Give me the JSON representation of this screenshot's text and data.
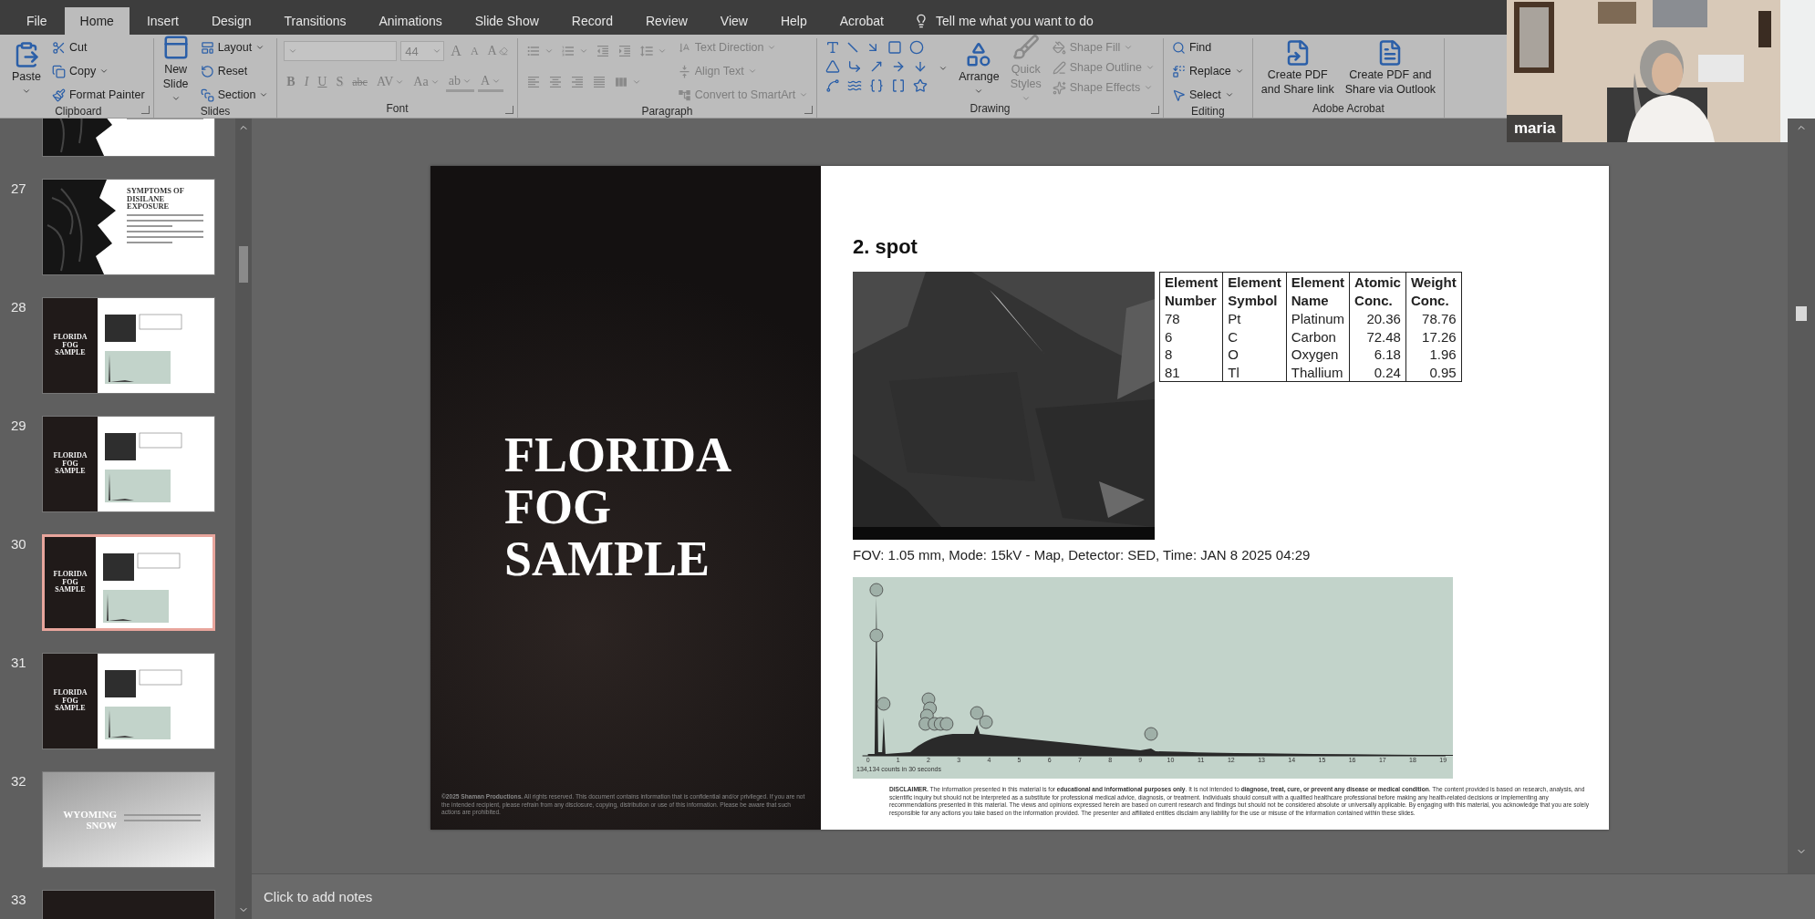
{
  "tabs": [
    {
      "label": "File",
      "selected": false
    },
    {
      "label": "Home",
      "selected": true
    },
    {
      "label": "Insert",
      "selected": false
    },
    {
      "label": "Design",
      "selected": false
    },
    {
      "label": "Transitions",
      "selected": false
    },
    {
      "label": "Animations",
      "selected": false
    },
    {
      "label": "Slide Show",
      "selected": false
    },
    {
      "label": "Record",
      "selected": false
    },
    {
      "label": "Review",
      "selected": false
    },
    {
      "label": "View",
      "selected": false
    },
    {
      "label": "Help",
      "selected": false
    },
    {
      "label": "Acrobat",
      "selected": false
    }
  ],
  "tell_me": "Tell me what you want to do",
  "ribbon": [
    {
      "label": "Clipboard",
      "kind": "clipboard",
      "launcher": true,
      "columns": [
        [
          [
            {
              "kind": "large",
              "label": "Paste",
              "dropdown": true,
              "disabled": false
            }
          ]
        ],
        [
          [
            {
              "kind": "small",
              "label": "Cut",
              "dropdown": false,
              "disabled": false
            }
          ],
          [
            {
              "kind": "small",
              "label": "Copy",
              "dropdown": true,
              "disabled": false
            }
          ],
          [
            {
              "kind": "small",
              "label": "Format Painter",
              "dropdown": false,
              "disabled": false
            }
          ]
        ]
      ]
    },
    {
      "label": "Slides",
      "kind": "slides",
      "launcher": false,
      "columns": [
        [
          [
            {
              "kind": "large",
              "label": "New\nSlide",
              "dropdown": true,
              "disabled": false
            }
          ]
        ],
        [
          [
            {
              "kind": "small",
              "label": "Layout",
              "dropdown": true,
              "disabled": false
            }
          ],
          [
            {
              "kind": "small",
              "label": "Reset",
              "dropdown": false,
              "disabled": false
            }
          ],
          [
            {
              "kind": "small",
              "label": "Section",
              "dropdown": true,
              "disabled": false
            }
          ]
        ]
      ]
    },
    {
      "label": "Font",
      "kind": "font",
      "launcher": true,
      "columns": [
        [
          [
            {
              "kind": "font-field",
              "dropdown": true,
              "disabled": true
            },
            {
              "kind": "size-field",
              "value": "44",
              "dropdown": true,
              "disabled": true
            },
            {
              "kind": "grow",
              "label": "A",
              "dropdown": false,
              "disabled": true
            },
            {
              "kind": "shrink",
              "label": "A",
              "dropdown": false,
              "disabled": true
            },
            {
              "kind": "clear",
              "label": "A",
              "dropdown": false,
              "disabled": true
            }
          ],
          [
            {
              "kind": "bold",
              "label": "B",
              "dropdown": false,
              "disabled": true
            },
            {
              "kind": "italic",
              "label": "I",
              "dropdown": false,
              "disabled": true
            },
            {
              "kind": "underline",
              "label": "U",
              "dropdown": false,
              "disabled": true
            },
            {
              "kind": "shadow",
              "label": "S",
              "dropdown": false,
              "disabled": true
            },
            {
              "kind": "strike",
              "label": "abc",
              "dropdown": false,
              "disabled": true
            },
            {
              "kind": "spacing",
              "label": "AV",
              "dropdown": true,
              "disabled": true
            },
            {
              "kind": "case",
              "label": "Aa",
              "dropdown": true,
              "disabled": true
            },
            {
              "kind": "highlight",
              "label": "ab",
              "dropdown": true,
              "disabled": true
            },
            {
              "kind": "color",
              "label": "A",
              "dropdown": true,
              "disabled": true
            }
          ]
        ]
      ]
    },
    {
      "label": "Paragraph",
      "kind": "paragraph",
      "launcher": true,
      "columns": [
        [
          [
            {
              "kind": "icon",
              "dropdown": true,
              "disabled": true
            },
            {
              "kind": "icon",
              "dropdown": true,
              "disabled": true
            },
            {
              "kind": "icon",
              "dropdown": false,
              "disabled": true
            },
            {
              "kind": "icon",
              "dropdown": false,
              "disabled": true
            },
            {
              "kind": "icon",
              "dropdown": true,
              "disabled": true
            }
          ],
          [
            {
              "kind": "icon",
              "dropdown": false,
              "disabled": true
            },
            {
              "kind": "icon",
              "dropdown": false,
              "disabled": true
            },
            {
              "kind": "icon",
              "dropdown": false,
              "disabled": true
            },
            {
              "kind": "icon",
              "dropdown": false,
              "disabled": true
            },
            {
              "kind": "icon",
              "dropdown": true,
              "disabled": true
            }
          ]
        ],
        [
          [
            {
              "kind": "small",
              "label": "Text Direction",
              "dropdown": true,
              "disabled": true
            }
          ],
          [
            {
              "kind": "small",
              "label": "Align Text",
              "dropdown": true,
              "disabled": true
            }
          ],
          [
            {
              "kind": "small",
              "label": "Convert to SmartArt",
              "dropdown": true,
              "disabled": true
            }
          ]
        ]
      ]
    },
    {
      "label": "Drawing",
      "kind": "drawing",
      "launcher": true,
      "columns": [
        [
          [
            {
              "kind": "icon",
              "dropdown": false,
              "disabled": false
            },
            {
              "kind": "icon",
              "dropdown": false,
              "disabled": false
            },
            {
              "kind": "icon",
              "dropdown": false,
              "disabled": false
            },
            {
              "kind": "icon",
              "dropdown": false,
              "disabled": false
            },
            {
              "kind": "icon",
              "dropdown": false,
              "disabled": false
            }
          ],
          [
            {
              "kind": "icon",
              "dropdown": false,
              "disabled": false
            },
            {
              "kind": "icon",
              "dropdown": false,
              "disabled": false
            },
            {
              "kind": "icon",
              "dropdown": false,
              "disabled": false
            },
            {
              "kind": "icon",
              "dropdown": false,
              "disabled": false
            },
            {
              "kind": "icon",
              "dropdown": false,
              "disabled": false
            }
          ],
          [
            {
              "kind": "icon",
              "dropdown": false,
              "disabled": false
            },
            {
              "kind": "icon",
              "dropdown": false,
              "disabled": false
            },
            {
              "kind": "icon",
              "dropdown": false,
              "disabled": false
            },
            {
              "kind": "icon",
              "dropdown": false,
              "disabled": false
            },
            {
              "kind": "icon",
              "dropdown": false,
              "disabled": false
            }
          ]
        ],
        [
          [
            {
              "kind": "more",
              "dropdown": true,
              "disabled": false
            }
          ]
        ],
        [
          [
            {
              "kind": "large",
              "label": "Arrange",
              "dropdown": true,
              "disabled": false
            }
          ]
        ],
        [
          [
            {
              "kind": "large",
              "label": "Quick\nStyles",
              "dropdown": true,
              "disabled": true
            }
          ]
        ],
        [
          [
            {
              "kind": "small",
              "label": "Shape Fill",
              "dropdown": true,
              "disabled": true
            }
          ],
          [
            {
              "kind": "small",
              "label": "Shape Outline",
              "dropdown": true,
              "disabled": true
            }
          ],
          [
            {
              "kind": "small",
              "label": "Shape Effects",
              "dropdown": true,
              "disabled": true
            }
          ]
        ]
      ]
    },
    {
      "label": "Editing",
      "kind": "editing",
      "launcher": false,
      "columns": [
        [
          [
            {
              "kind": "small",
              "label": "Find",
              "dropdown": false,
              "disabled": false
            }
          ],
          [
            {
              "kind": "small",
              "label": "Replace",
              "dropdown": true,
              "disabled": false
            }
          ],
          [
            {
              "kind": "small",
              "label": "Select",
              "dropdown": true,
              "disabled": false
            }
          ]
        ]
      ]
    },
    {
      "label": "Adobe Acrobat",
      "kind": "acrobat",
      "launcher": false,
      "columns": [
        [
          [
            {
              "kind": "large",
              "label": "Create PDF\nand Share link",
              "dropdown": false,
              "disabled": false
            }
          ]
        ],
        [
          [
            {
              "kind": "large",
              "label": "Create PDF and\nShare via Outlook",
              "dropdown": false,
              "disabled": false
            }
          ]
        ]
      ]
    }
  ],
  "webcam": {
    "name": "maria"
  },
  "slides": [
    {
      "kind": "dark-art",
      "selected": false
    },
    {
      "number": "27",
      "title": "SYMPTOMS OF DISILANE EXPOSURE",
      "kind": "dark-art",
      "selected": false
    },
    {
      "number": "28",
      "title": "FLORIDA FOG SAMPLE",
      "kind": "fog",
      "selected": false
    },
    {
      "number": "29",
      "title": "FLORIDA FOG SAMPLE",
      "kind": "fog",
      "selected": false
    },
    {
      "number": "30",
      "title": "FLORIDA FOG SAMPLE",
      "kind": "fog",
      "selected": true
    },
    {
      "number": "31",
      "title": "FLORIDA FOG SAMPLE",
      "kind": "fog",
      "selected": false
    },
    {
      "number": "32",
      "title": "WYOMING SNOW",
      "kind": "snow",
      "selected": false
    },
    {
      "number": "33",
      "kind": "dark",
      "selected": false
    }
  ],
  "slide": {
    "title": "FLORIDA FOG SAMPLE",
    "copyright": "**©2025 Shaman Productions.** All rights reserved. This document contains information that is confidential and/or privileged. If you are not the intended recipient, please refrain from any disclosure, copying, distribution or use of this information. Please be aware that such actions are prohibited.",
    "heading": "2. spot",
    "table": {
      "columns": [
        "Element\nNumber",
        "Element\nSymbol",
        "Element\nName",
        "Atomic\nConc.",
        "Weight\nConc."
      ],
      "rows": [
        [
          "78",
          "Pt",
          "Platinum",
          "20.36",
          "78.76"
        ],
        [
          "6",
          "C",
          "Carbon",
          "72.48",
          "17.26"
        ],
        [
          "8",
          "O",
          "Oxygen",
          "6.18",
          "1.96"
        ],
        [
          "81",
          "Tl",
          "Thallium",
          "0.24",
          "0.95"
        ]
      ]
    },
    "caption": "FOV: 1.05 mm, Mode: 15kV - Map, Detector: SED, Time: JAN 8 2025 04:29",
    "spectrum": {
      "ticks": [
        "0",
        "1",
        "2",
        "3",
        "4",
        "5",
        "6",
        "7",
        "8",
        "9",
        "10",
        "11",
        "12",
        "13",
        "14",
        "15",
        "16",
        "17",
        "18",
        "19"
      ],
      "counts": "134,134 counts in 30 seconds"
    },
    "disclaimer": "**DISCLAIMER.** The information presented in this material is for **educational and informational purposes only**. It is not intended to **diagnose, treat, cure, or prevent any disease or medical condition**. The content provided is based on research, analysis, and scientific inquiry but should not be interpreted as a substitute for professional medical advice, diagnosis, or treatment. Individuals should consult with a qualified healthcare professional before making any health-related decisions or implementing any recommendations presented in this material. The views and opinions expressed herein are based on current research and findings but should not be considered absolute or universally applicable. By engaging with this material, you acknowledge that you are solely responsible for any actions you take based on the information provided. The presenter and affiliated entities disclaim any liability for the use or misuse of the information contained within these slides."
  },
  "notes_placeholder": "Click to add notes"
}
